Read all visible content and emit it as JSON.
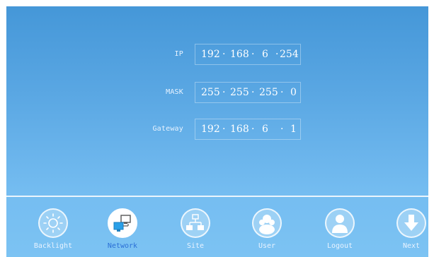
{
  "network": {
    "ip": {
      "label": "IP",
      "octets": [
        "192",
        "168",
        "6",
        "254"
      ]
    },
    "mask": {
      "label": "MASK",
      "octets": [
        "255",
        "255",
        "255",
        "0"
      ]
    },
    "gateway": {
      "label": "Gateway",
      "octets": [
        "192",
        "168",
        "6",
        "1"
      ]
    },
    "separator": "·"
  },
  "toolbar": {
    "items": [
      {
        "label": "Backlight",
        "icon": "sun-icon"
      },
      {
        "label": "Network",
        "icon": "network-computers-icon",
        "active": true
      },
      {
        "label": "Site",
        "icon": "site-hierarchy-icon"
      },
      {
        "label": "User",
        "icon": "users-icon"
      },
      {
        "label": "Logout",
        "icon": "person-logout-icon"
      },
      {
        "label": "Next",
        "icon": "arrow-down-icon"
      }
    ]
  },
  "colors": {
    "background_top": "#4597d8",
    "background_bottom": "#7cc3f3",
    "active_label": "#2a6fd6"
  }
}
